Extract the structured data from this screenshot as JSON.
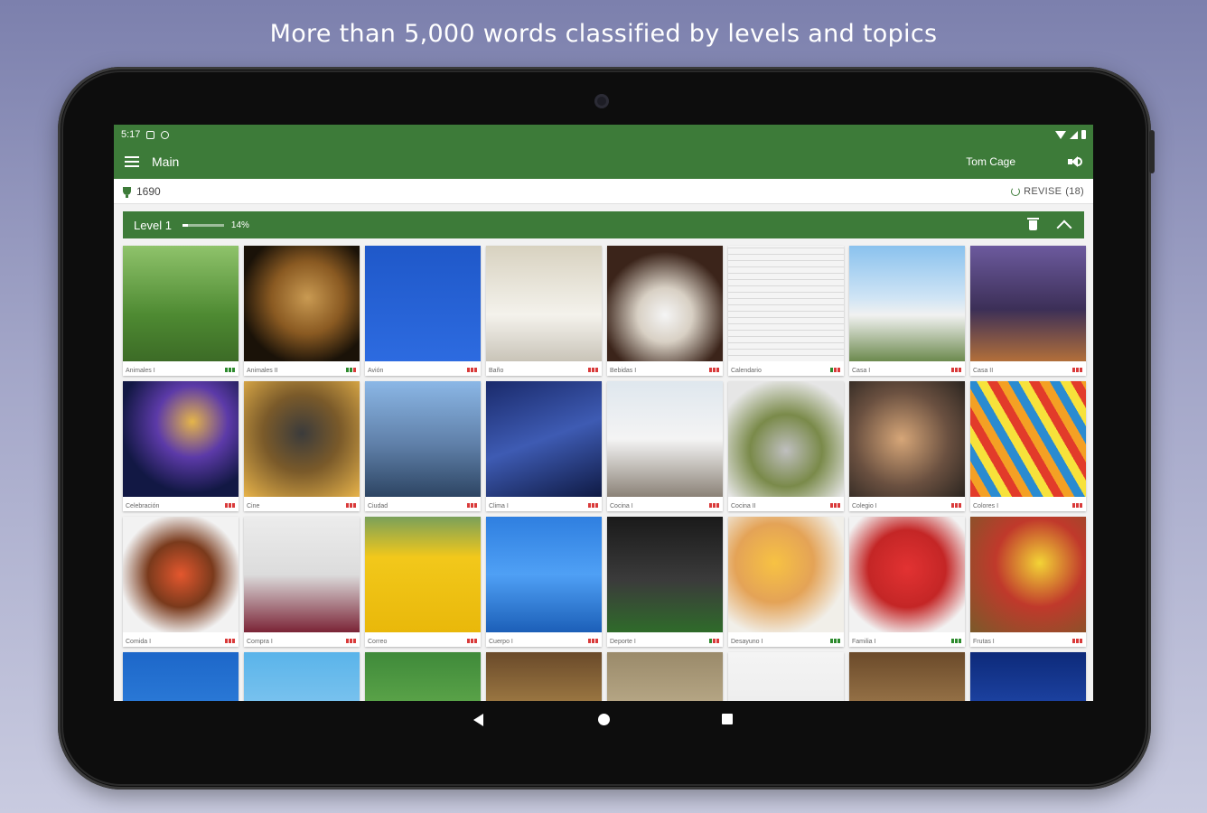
{
  "headline": "More than 5,000 words classified by levels and topics",
  "status": {
    "time": "5:17"
  },
  "appbar": {
    "title": "Main",
    "user": "Tom Cage"
  },
  "score": {
    "points": "1690",
    "revise_label": "REVISE",
    "revise_count": "(18)"
  },
  "level": {
    "label": "Level 1",
    "progress_pct": 14,
    "progress_label": "14%"
  },
  "colors": {
    "accent": "#3d7b39",
    "mark_green": "#2e8b2e",
    "mark_red": "#d93a3a"
  },
  "topics": [
    {
      "label": "Animales I",
      "marks": [
        "g",
        "g",
        "g"
      ]
    },
    {
      "label": "Animales II",
      "marks": [
        "g",
        "g",
        "r"
      ]
    },
    {
      "label": "Avión",
      "marks": [
        "r",
        "r",
        "r"
      ]
    },
    {
      "label": "Baño",
      "marks": [
        "r",
        "r",
        "r"
      ]
    },
    {
      "label": "Bebidas I",
      "marks": [
        "r",
        "r",
        "r"
      ]
    },
    {
      "label": "Calendario",
      "marks": [
        "g",
        "r",
        "r"
      ]
    },
    {
      "label": "Casa I",
      "marks": [
        "r",
        "r",
        "r"
      ]
    },
    {
      "label": "Casa II",
      "marks": [
        "r",
        "r",
        "r"
      ]
    },
    {
      "label": "Celebración",
      "marks": [
        "r",
        "r",
        "r"
      ]
    },
    {
      "label": "Cine",
      "marks": [
        "r",
        "r",
        "r"
      ]
    },
    {
      "label": "Ciudad",
      "marks": [
        "r",
        "r",
        "r"
      ]
    },
    {
      "label": "Clima I",
      "marks": [
        "r",
        "r",
        "r"
      ]
    },
    {
      "label": "Cocina I",
      "marks": [
        "r",
        "r",
        "r"
      ]
    },
    {
      "label": "Cocina II",
      "marks": [
        "r",
        "r",
        "r"
      ]
    },
    {
      "label": "Colegio I",
      "marks": [
        "r",
        "r",
        "r"
      ]
    },
    {
      "label": "Colores I",
      "marks": [
        "r",
        "r",
        "r"
      ]
    },
    {
      "label": "Comida I",
      "marks": [
        "r",
        "r",
        "r"
      ]
    },
    {
      "label": "Compra I",
      "marks": [
        "r",
        "r",
        "r"
      ]
    },
    {
      "label": "Correo",
      "marks": [
        "r",
        "r",
        "r"
      ]
    },
    {
      "label": "Cuerpo I",
      "marks": [
        "r",
        "r",
        "r"
      ]
    },
    {
      "label": "Deporte I",
      "marks": [
        "g",
        "r",
        "r"
      ]
    },
    {
      "label": "Desayuno I",
      "marks": [
        "g",
        "g",
        "g"
      ]
    },
    {
      "label": "Familia I",
      "marks": [
        "g",
        "g",
        "g"
      ]
    },
    {
      "label": "Frutas I",
      "marks": [
        "r",
        "r",
        "r"
      ]
    },
    {
      "label": "",
      "marks": []
    },
    {
      "label": "",
      "marks": []
    },
    {
      "label": "",
      "marks": []
    },
    {
      "label": "",
      "marks": []
    },
    {
      "label": "",
      "marks": []
    },
    {
      "label": "",
      "marks": []
    },
    {
      "label": "",
      "marks": []
    },
    {
      "label": "",
      "marks": []
    }
  ]
}
